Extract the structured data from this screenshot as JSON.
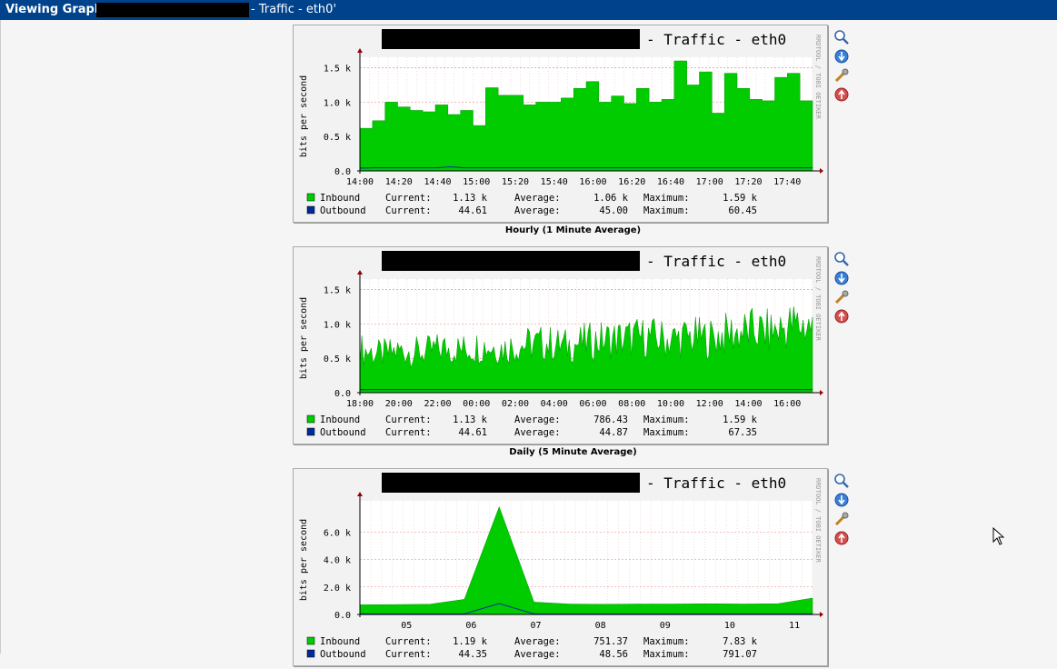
{
  "header": {
    "title": "Viewing Graph",
    "subtitle": "- Traffic - eth0'"
  },
  "graphs": [
    {
      "title": "- Traffic - eth0",
      "ylabel": "bits per second",
      "watermark": "RRDTOOL / TOBI OETIKER",
      "yticks": [
        "1.5 k",
        "1.0 k",
        "0.5 k",
        "0.0"
      ],
      "xticks": [
        "14:00",
        "14:20",
        "14:40",
        "15:00",
        "15:20",
        "15:40",
        "16:00",
        "16:20",
        "16:40",
        "17:00",
        "17:20",
        "17:40"
      ],
      "legend": [
        {
          "name": "Inbound",
          "current": "1.13 k",
          "average": "1.06 k",
          "maximum": "1.59 k",
          "color": "#00cc00"
        },
        {
          "name": "Outbound",
          "current": "44.61",
          "average": "45.00",
          "maximum": "60.45",
          "color": "#002a97"
        }
      ],
      "caption": "Hourly (1 Minute Average)"
    },
    {
      "title": "- Traffic - eth0",
      "ylabel": "bits per second",
      "watermark": "RRDTOOL / TOBI OETIKER",
      "yticks": [
        "1.5 k",
        "1.0 k",
        "0.5 k",
        "0.0"
      ],
      "xticks": [
        "18:00",
        "20:00",
        "22:00",
        "00:00",
        "02:00",
        "04:00",
        "06:00",
        "08:00",
        "10:00",
        "12:00",
        "14:00",
        "16:00"
      ],
      "legend": [
        {
          "name": "Inbound",
          "current": "1.13 k",
          "average": "786.43",
          "maximum": "1.59 k",
          "color": "#00cc00"
        },
        {
          "name": "Outbound",
          "current": "44.61",
          "average": "44.87",
          "maximum": "67.35",
          "color": "#002a97"
        }
      ],
      "caption": "Daily (5 Minute Average)"
    },
    {
      "title": "- Traffic - eth0",
      "ylabel": "bits per second",
      "watermark": "RRDTOOL / TOBI OETIKER",
      "yticks": [
        "6.0 k",
        "4.0 k",
        "2.0 k",
        "0.0"
      ],
      "xticks": [
        "05",
        "06",
        "07",
        "08",
        "09",
        "10",
        "11"
      ],
      "legend": [
        {
          "name": "Inbound",
          "current": "1.19 k",
          "average": "751.37",
          "maximum": "7.83 k",
          "color": "#00cc00"
        },
        {
          "name": "Outbound",
          "current": "44.35",
          "average": "48.56",
          "maximum": "791.07",
          "color": "#002a97"
        }
      ],
      "caption": ""
    }
  ],
  "labels": {
    "current": "Current:",
    "average": "Average:",
    "maximum": "Maximum:"
  },
  "icons": [
    "zoom-icon",
    "download-icon",
    "edit-icon",
    "move-up-icon"
  ],
  "chart_data": [
    {
      "type": "area",
      "title": "- Traffic - eth0",
      "ylabel": "bits per second",
      "ylim": [
        0,
        1600
      ],
      "x": [
        "14:00",
        "14:20",
        "14:40",
        "15:00",
        "15:20",
        "15:40",
        "16:00",
        "16:20",
        "16:40",
        "17:00",
        "17:20",
        "17:40"
      ],
      "series": [
        {
          "name": "Inbound",
          "values": [
            620,
            730,
            1000,
            930,
            880,
            860,
            960,
            820,
            880,
            660,
            1210,
            1100,
            1100,
            960,
            1000,
            1000,
            1060,
            1200,
            1300,
            1000,
            1090,
            980,
            1200,
            1000,
            1040,
            1600,
            1250,
            1440,
            840,
            1420,
            1200,
            1040,
            1020,
            1360,
            1420,
            1020
          ]
        },
        {
          "name": "Outbound",
          "values": [
            40,
            45,
            45,
            45,
            45,
            45,
            45,
            60,
            45,
            45,
            45,
            45,
            45,
            45,
            45,
            45,
            45,
            45,
            45,
            45,
            45,
            45,
            45,
            45,
            45,
            45,
            45,
            45,
            45,
            45,
            45,
            45,
            45,
            45,
            45,
            45
          ]
        }
      ]
    },
    {
      "type": "area",
      "title": "- Traffic - eth0",
      "ylabel": "bits per second",
      "ylim": [
        0,
        1600
      ],
      "x": [
        "18:00",
        "20:00",
        "22:00",
        "00:00",
        "02:00",
        "04:00",
        "06:00",
        "08:00",
        "10:00",
        "12:00",
        "14:00",
        "16:00"
      ],
      "series": [
        {
          "name": "Inbound",
          "values": [
            700,
            620,
            680,
            650,
            720,
            700,
            760,
            720,
            780,
            800,
            760,
            820,
            860,
            880,
            900,
            860,
            900,
            880,
            960,
            1000,
            980,
            1100,
            1080
          ]
        },
        {
          "name": "Outbound",
          "values": [
            45,
            45,
            45,
            45,
            45,
            45,
            45,
            45,
            45,
            45,
            45,
            45,
            45,
            45,
            45,
            45,
            45,
            45,
            45,
            45,
            45,
            45,
            45
          ]
        }
      ]
    },
    {
      "type": "area",
      "title": "- Traffic - eth0",
      "ylabel": "bits per second",
      "ylim": [
        0,
        8000
      ],
      "x": [
        "05",
        "06",
        "07",
        "08",
        "09",
        "10",
        "11"
      ],
      "series": [
        {
          "name": "Inbound",
          "values": [
            700,
            720,
            740,
            1100,
            7830,
            900,
            760,
            740,
            760,
            760,
            780,
            760,
            780,
            1190
          ]
        },
        {
          "name": "Outbound",
          "values": [
            44,
            45,
            45,
            45,
            791,
            45,
            45,
            45,
            45,
            45,
            45,
            45,
            45,
            44
          ]
        }
      ]
    }
  ]
}
